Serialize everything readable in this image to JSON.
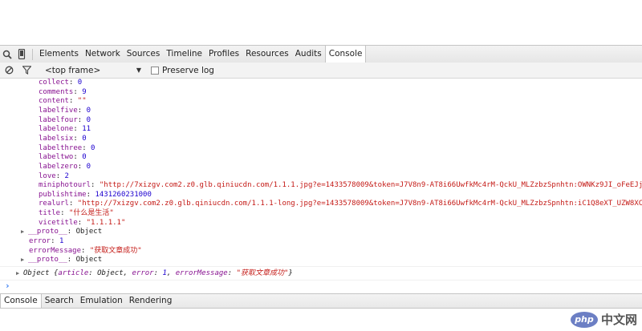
{
  "toolbar": {
    "tabs": [
      "Elements",
      "Network",
      "Sources",
      "Timeline",
      "Profiles",
      "Resources",
      "Audits",
      "Console"
    ]
  },
  "console_toolbar": {
    "frame": "<top frame>",
    "preserve_log": "Preserve log"
  },
  "console": {
    "lines": [
      {
        "key": "collect",
        "value": "0",
        "type": "number"
      },
      {
        "key": "comments",
        "value": "9",
        "type": "number"
      },
      {
        "key": "content",
        "value": "\"\"",
        "type": "string"
      },
      {
        "key": "labelfive",
        "value": "0",
        "type": "number"
      },
      {
        "key": "labelfour",
        "value": "0",
        "type": "number"
      },
      {
        "key": "labelone",
        "value": "11",
        "type": "number"
      },
      {
        "key": "labelsix",
        "value": "0",
        "type": "number"
      },
      {
        "key": "labelthree",
        "value": "0",
        "type": "number"
      },
      {
        "key": "labeltwo",
        "value": "0",
        "type": "number"
      },
      {
        "key": "labelzero",
        "value": "0",
        "type": "number"
      },
      {
        "key": "love",
        "value": "2",
        "type": "number"
      },
      {
        "key": "miniphotourl",
        "value": "\"http://7xizgv.com2.z0.glb.qiniucdn.com/1.1.1.jpg?e=1433578009&token=J7V8n9-AT8i66UwfkMc4rM-QckU_MLZzbzSpnhtn:OWNKz9JI_oFeEJj",
        "type": "string"
      },
      {
        "key": "publishtime",
        "value": "1431260231000",
        "type": "number"
      },
      {
        "key": "realurl",
        "value": "\"http://7xizgv.com2.z0.glb.qiniucdn.com/1.1.1-long.jpg?e=1433578009&token=J7V8n9-AT8i66UwfkMc4rM-QckU_MLZzbzSpnhtn:iC1Q8eXT_UZW8XC",
        "type": "string"
      },
      {
        "key": "title",
        "value": "\"什么是生活\"",
        "type": "string"
      },
      {
        "key": "vicetitle",
        "value": "\"1.1.1.1\"",
        "type": "string"
      },
      {
        "key": "__proto__",
        "value": "Object",
        "type": "proto"
      },
      {
        "key": "error",
        "value": "1",
        "type": "number"
      },
      {
        "key": "errorMessage",
        "value": "\"获取文章成功\"",
        "type": "string"
      },
      {
        "key": "__proto__",
        "value": "Object",
        "type": "proto"
      }
    ],
    "summary": {
      "prefix": "Object {",
      "article_key": "article",
      "article_val": "Object",
      "error_key": "error",
      "error_val": "1",
      "msg_key": "errorMessage",
      "msg_val": "\"获取文章成功\"",
      "suffix": "}"
    },
    "prompt": "›"
  },
  "drawer": {
    "tabs": [
      "Console",
      "Search",
      "Emulation",
      "Rendering"
    ]
  },
  "watermark": {
    "logo": "php",
    "text": "中文网"
  }
}
